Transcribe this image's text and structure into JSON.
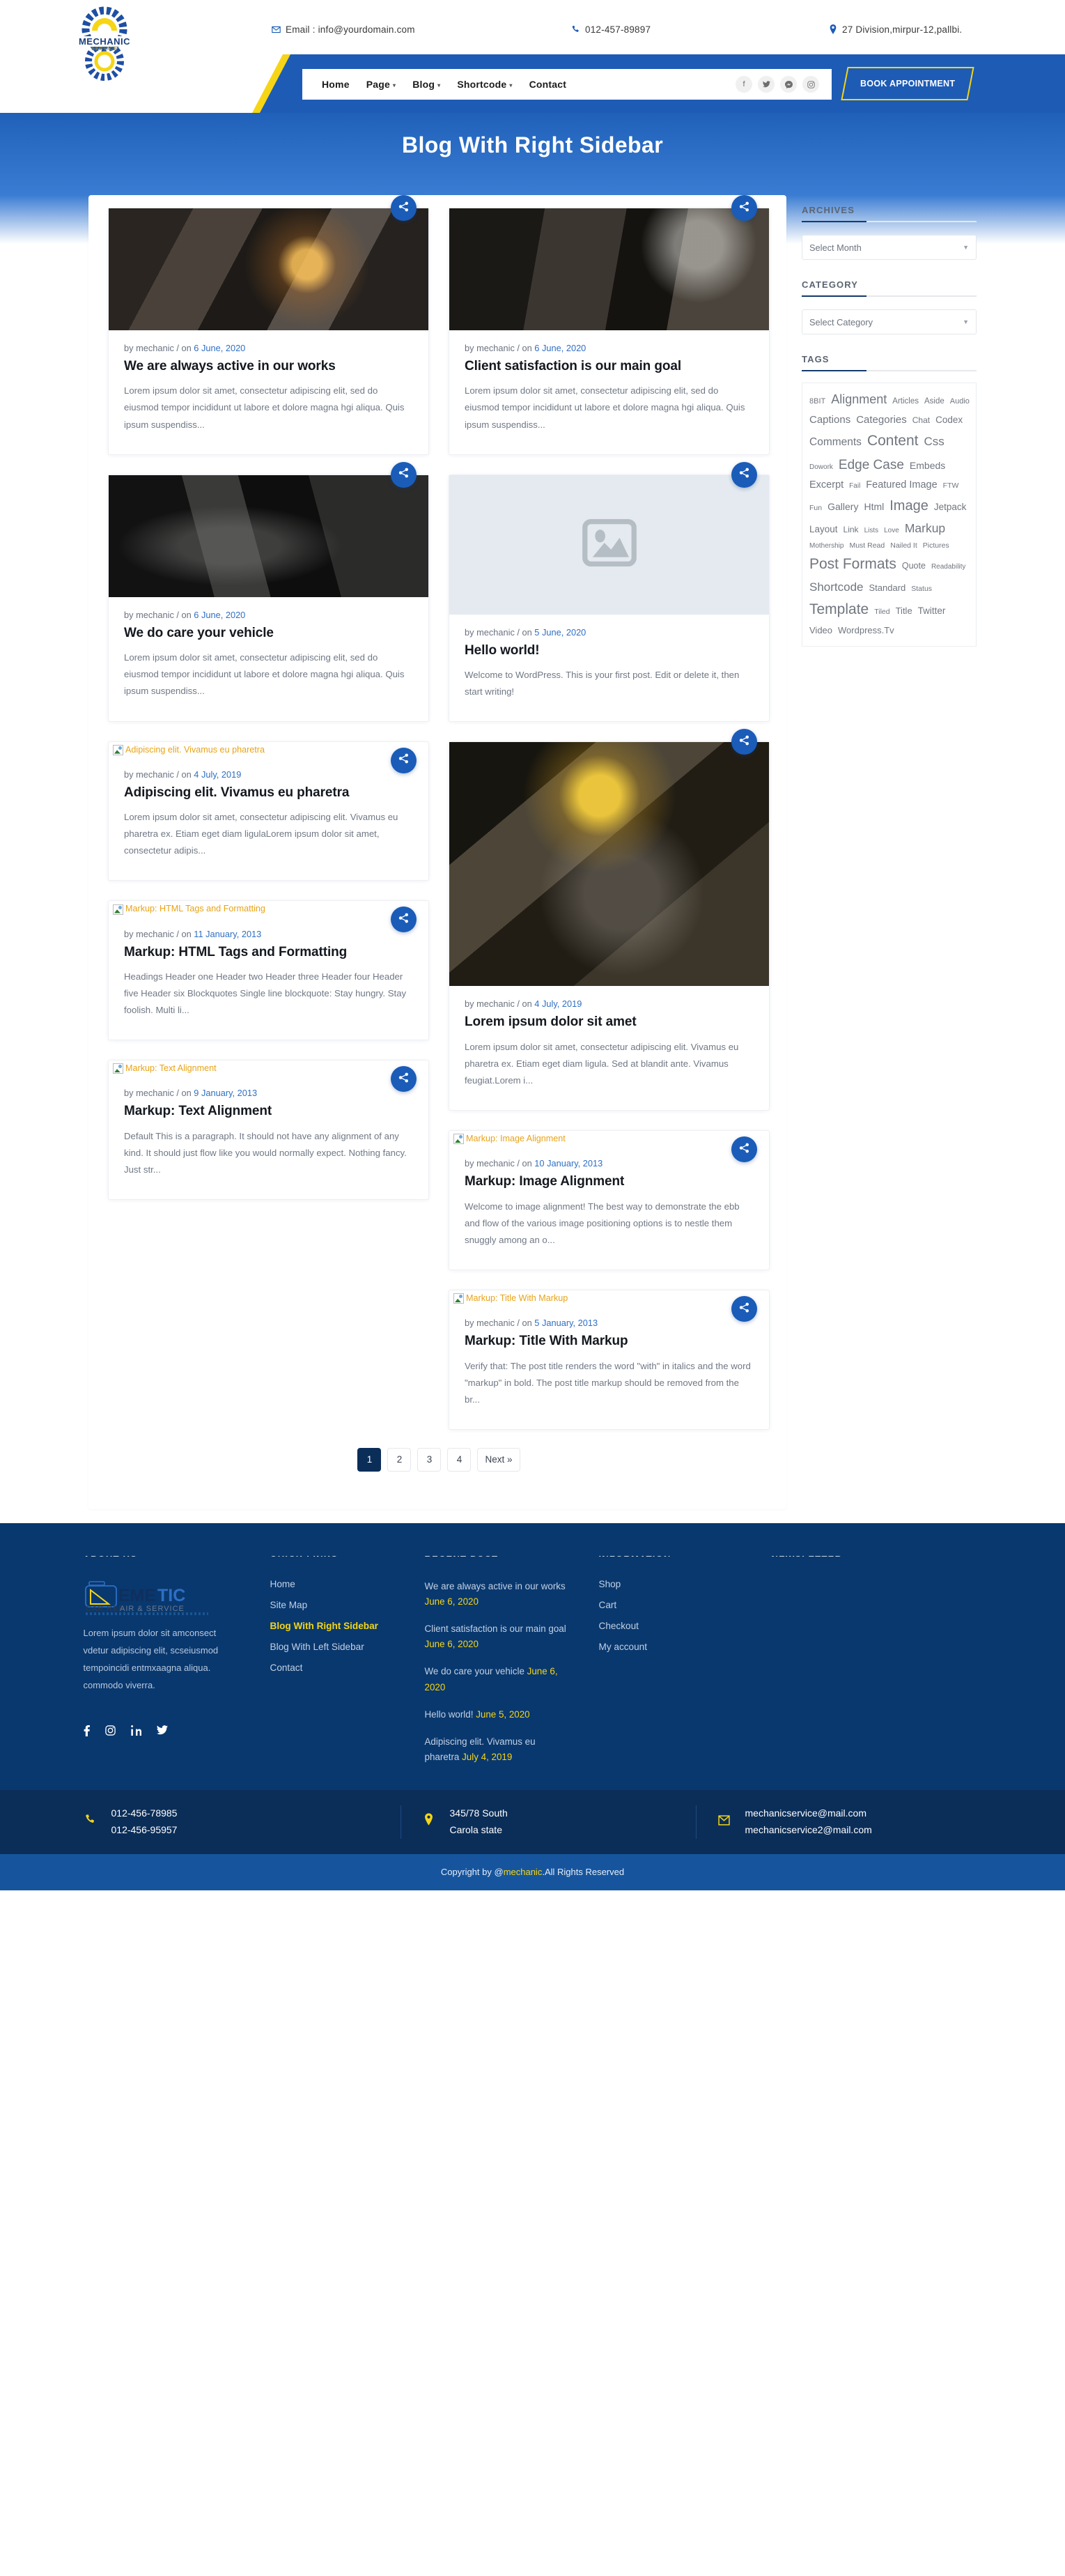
{
  "topbar": {
    "email_label": "Email : info@yourdomain.com",
    "phone": "012-457-89897",
    "address": "27 Division,mirpur-12,pallbi.",
    "logo_text": "MECHANIC",
    "logo_sub": "SERVICE"
  },
  "nav": {
    "items": [
      {
        "label": "Home",
        "has_caret": false
      },
      {
        "label": "Page",
        "has_caret": true
      },
      {
        "label": "Blog",
        "has_caret": true
      },
      {
        "label": "Shortcode",
        "has_caret": true
      },
      {
        "label": "Contact",
        "has_caret": false
      }
    ],
    "social": [
      "f",
      "t",
      "m",
      "i"
    ],
    "book_button": "BOOK APPOINTMENT"
  },
  "banner": {
    "title": "Blog With Right Sidebar"
  },
  "posts": [
    {
      "col": 0,
      "thumb": "photo-workshop-grinder",
      "thumb_kind": "image",
      "meta_prefix": "by mechanic / on ",
      "date": "6 June, 2020",
      "title": "We are always active in our works",
      "excerpt": "Lorem ipsum dolor sit amet, consectetur adipiscing elit, sed do eiusmod tempor incididunt ut labore et dolore magna hgi aliqua. Quis ipsum suspendiss..."
    },
    {
      "col": 1,
      "thumb": "photo-mechanic-engine",
      "thumb_kind": "image",
      "meta_prefix": "by mechanic / on ",
      "date": "6 June, 2020",
      "title": "Client satisfaction is our main goal",
      "excerpt": "Lorem ipsum dolor sit amet, consectetur adipiscing elit, sed do eiusmod tempor incididunt ut labore et dolore magna hgi aliqua. Quis ipsum suspendiss..."
    },
    {
      "col": 0,
      "thumb": "photo-mechanic-car-repair",
      "thumb_kind": "image",
      "meta_prefix": "by mechanic / on ",
      "date": "6 June, 2020",
      "title": "We do care your vehicle",
      "excerpt": "Lorem ipsum dolor sit amet, consectetur adipiscing elit, sed do eiusmod tempor incididunt ut labore et dolore magna hgi aliqua. Quis ipsum suspendiss..."
    },
    {
      "col": 1,
      "thumb": "image-placeholder",
      "thumb_kind": "placeholder",
      "meta_prefix": "by mechanic / on ",
      "date": "5 June, 2020",
      "title": "Hello world!",
      "excerpt": "Welcome to WordPress. This is your first post. Edit or delete it, then start writing!"
    },
    {
      "col": 0,
      "thumb": "Adipiscing elit. Vivamus eu pharetra",
      "thumb_kind": "broken",
      "meta_prefix": "by mechanic / on ",
      "date": "4 July, 2019",
      "title": "Adipiscing elit. Vivamus eu pharetra",
      "excerpt": "Lorem ipsum dolor sit amet, consectetur adipiscing elit. Vivamus eu pharetra ex. Etiam eget diam ligulaLorem ipsum dolor sit amet, consectetur adipis..."
    },
    {
      "col": 1,
      "thumb": "photo-welder-sparks",
      "thumb_kind": "image-tall",
      "meta_prefix": "by mechanic / on ",
      "date": "4 July, 2019",
      "title": "Lorem ipsum dolor sit amet",
      "excerpt": "Lorem ipsum dolor sit amet, consectetur adipiscing elit. Vivamus eu pharetra ex. Etiam eget diam ligula. Sed at blandit ante. Vivamus feugiat.Lorem i..."
    },
    {
      "col": 0,
      "thumb": "Markup: HTML Tags and Formatting",
      "thumb_kind": "broken",
      "meta_prefix": "by mechanic / on ",
      "date": "11 January, 2013",
      "title": "Markup: HTML Tags and Formatting",
      "excerpt": "Headings Header one Header two Header three Header four Header five Header six Blockquotes Single line blockquote: Stay hungry. Stay foolish. Multi li..."
    },
    {
      "col": 1,
      "thumb": "Markup: Image Alignment",
      "thumb_kind": "broken",
      "meta_prefix": "by mechanic / on ",
      "date": "10 January, 2013",
      "title": "Markup: Image Alignment",
      "excerpt": "Welcome to image alignment! The best way to demonstrate the ebb and flow of the various image positioning options is to nestle them snuggly among an o..."
    },
    {
      "col": 0,
      "thumb": "Markup: Text Alignment",
      "thumb_kind": "broken",
      "meta_prefix": "by mechanic / on ",
      "date": "9 January, 2013",
      "title": "Markup: Text Alignment",
      "excerpt": "Default This is a paragraph. It should not have any alignment of any kind. It should just flow like you would normally expect. Nothing fancy. Just str..."
    },
    {
      "col": 1,
      "thumb": "Markup: Title With Markup",
      "thumb_kind": "broken",
      "meta_prefix": "by mechanic / on ",
      "date": "5 January, 2013",
      "title": "Markup: Title With Markup",
      "excerpt": "Verify that: The post title renders the word \"with\" in italics and the word \"markup\" in bold. The post title markup should be removed from the br..."
    }
  ],
  "sidebar": {
    "archives": {
      "title": "ARCHIVES",
      "select_value": "Select Month"
    },
    "category": {
      "title": "CATEGORY",
      "select_value": "Select Category"
    },
    "tags_title": "TAGS",
    "tags": [
      {
        "label": "8BIT",
        "size": 11
      },
      {
        "label": "Alignment",
        "size": 18
      },
      {
        "label": "Articles",
        "size": 11.5
      },
      {
        "label": "Aside",
        "size": 11.5
      },
      {
        "label": "Audio",
        "size": 11
      },
      {
        "label": "Captions",
        "size": 15
      },
      {
        "label": "Categories",
        "size": 15
      },
      {
        "label": "Chat",
        "size": 12
      },
      {
        "label": "Codex",
        "size": 13.5
      },
      {
        "label": "Comments",
        "size": 15.5
      },
      {
        "label": "Content",
        "size": 21
      },
      {
        "label": "Css",
        "size": 17
      },
      {
        "label": "Dowork",
        "size": 10
      },
      {
        "label": "Edge Case",
        "size": 19
      },
      {
        "label": "Embeds",
        "size": 14
      },
      {
        "label": "Excerpt",
        "size": 14.5
      },
      {
        "label": "Fail",
        "size": 10
      },
      {
        "label": "Featured Image",
        "size": 14.5
      },
      {
        "label": "FTW",
        "size": 10.5
      },
      {
        "label": "Fun",
        "size": 10.5
      },
      {
        "label": "Gallery",
        "size": 14
      },
      {
        "label": "Html",
        "size": 14
      },
      {
        "label": "Image",
        "size": 20
      },
      {
        "label": "Jetpack",
        "size": 13.5
      },
      {
        "label": "Layout",
        "size": 13.5
      },
      {
        "label": "Link",
        "size": 12
      },
      {
        "label": "Lists",
        "size": 10
      },
      {
        "label": "Love",
        "size": 10
      },
      {
        "label": "Markup",
        "size": 17.5
      },
      {
        "label": "Mothership",
        "size": 10
      },
      {
        "label": "Must Read",
        "size": 10.5
      },
      {
        "label": "Nailed It",
        "size": 10.5
      },
      {
        "label": "Pictures",
        "size": 10.5
      },
      {
        "label": "Post Formats",
        "size": 21
      },
      {
        "label": "Quote",
        "size": 12.5
      },
      {
        "label": "Readability",
        "size": 10
      },
      {
        "label": "Shortcode",
        "size": 17
      },
      {
        "label": "Standard",
        "size": 13
      },
      {
        "label": "Status",
        "size": 10.5
      },
      {
        "label": "Template",
        "size": 21
      },
      {
        "label": "Tiled",
        "size": 10.5
      },
      {
        "label": "Title",
        "size": 13
      },
      {
        "label": "Twitter",
        "size": 13.5
      },
      {
        "label": "Video",
        "size": 13
      },
      {
        "label": "Wordpress.Tv",
        "size": 13
      }
    ]
  },
  "pagination": {
    "pages": [
      "1",
      "2",
      "3",
      "4"
    ],
    "next_label": "Next »",
    "active": "1"
  },
  "footer": {
    "columns": {
      "about": {
        "heading": "ABOUT US",
        "logo_text": "MECHANIC",
        "logo_sub": "CAR REPAIR & SERVICE",
        "text": "Lorem ipsum dolor sit amconsect vdetur adipiscing elit, scseiusmod tempoincidi entmxaagna aliqua. commodo viverra.",
        "social": [
          "f",
          "i",
          "in",
          "t"
        ]
      },
      "quick_links": {
        "heading": "QUICK LINKS",
        "items": [
          {
            "label": "Home",
            "active": false
          },
          {
            "label": "Site Map",
            "active": false
          },
          {
            "label": "Blog With Right Sidebar",
            "active": true
          },
          {
            "label": "Blog With Left Sidebar",
            "active": false
          },
          {
            "label": "Contact",
            "active": false
          }
        ]
      },
      "recent_post": {
        "heading": "RECENT POST",
        "items": [
          {
            "title": "We are always active in our works ",
            "date": "June 6, 2020"
          },
          {
            "title": "Client satisfaction is our main goal ",
            "date": "June 6, 2020"
          },
          {
            "title": "We do care your vehicle ",
            "date": "June 6, 2020"
          },
          {
            "title": "Hello world! ",
            "date": "June 5, 2020"
          },
          {
            "title": "Adipiscing elit. Vivamus eu pharetra ",
            "date": "July 4, 2019"
          }
        ]
      },
      "information": {
        "heading": "INFORMATION",
        "items": [
          "Shop",
          "Cart",
          "Checkout",
          "My account"
        ]
      },
      "newsletter": {
        "heading": "NEWSLETTER"
      }
    }
  },
  "contactbar": {
    "phone": {
      "icon": "phone-icon",
      "line1": "012-456-78985",
      "line2": "012-456-95957"
    },
    "address": {
      "icon": "location-icon",
      "line1": "345/78 South",
      "line2": "Carola state"
    },
    "email": {
      "icon": "mail-icon",
      "line1": "mechanicservice@mail.com",
      "line2": "mechanicservice2@mail.com"
    }
  },
  "copyright": {
    "prefix": "Copyright by @",
    "brand": "mechanic",
    "suffix": ".All Rights Reserved"
  },
  "colors": {
    "primary_blue": "#1e5bb5",
    "accent_yellow": "#f5d516",
    "dark_navy": "#09386e",
    "share_blue": "#1a5cb8",
    "alt_text_orange": "#e8a317"
  }
}
